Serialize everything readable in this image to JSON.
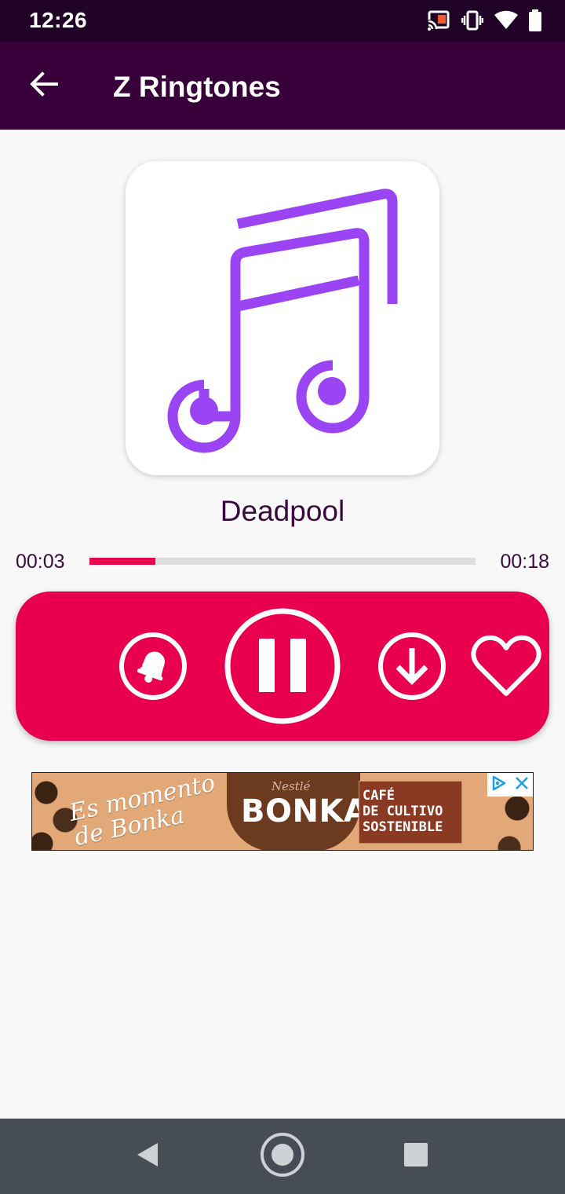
{
  "status_bar": {
    "time": "12:26",
    "icons": [
      "cast-icon",
      "vibrate-icon",
      "wifi-icon",
      "battery-icon"
    ]
  },
  "toolbar": {
    "title": "Z Ringtones",
    "back_icon": "arrow-back-icon"
  },
  "player": {
    "song_title": "Deadpool",
    "elapsed": "00:03",
    "total": "00:18",
    "progress_fraction": 0.17,
    "artwork_icon": "music-note-icon"
  },
  "controls": {
    "set_ringtone_icon": "bell-icon",
    "play_pause_icon": "pause-icon",
    "download_icon": "download-icon",
    "favorite_icon": "heart-icon"
  },
  "ad": {
    "slogan": "Es momento de Bonka",
    "brand_small": "Nestlé",
    "brand": "BONKA",
    "claim_line1": "CAFÉ",
    "claim_line2": "DE CULTIVO",
    "claim_line3": "SOSTENIBLE",
    "adchoices_icon": "adchoices-icon",
    "close_icon": "close-icon"
  },
  "nav_bar": {
    "back": "nav-back-icon",
    "home": "nav-home-icon",
    "recents": "nav-recents-icon"
  },
  "colors": {
    "status_bar_bg": "#220328",
    "toolbar_bg": "#38003a",
    "accent": "#e8004f",
    "artwork_purple": "#9b44f4",
    "text_dark": "#3a0a3e",
    "nav_bar_bg": "#474d54"
  }
}
